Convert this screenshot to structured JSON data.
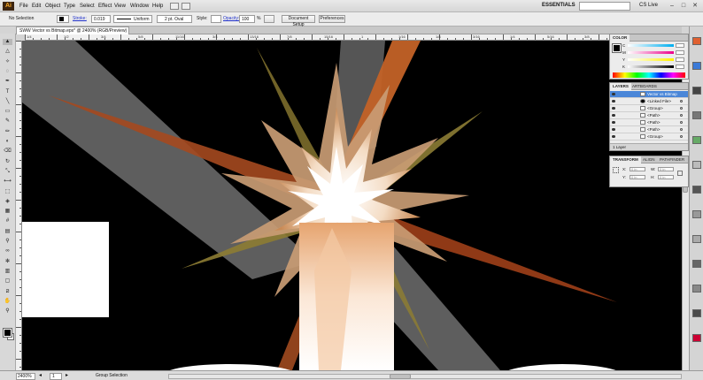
{
  "app": {
    "logo": "Ai"
  },
  "menu": {
    "items": [
      "File",
      "Edit",
      "Object",
      "Type",
      "Select",
      "Effect",
      "View",
      "Window",
      "Help"
    ]
  },
  "workspace": {
    "label": "ESSENTIALS",
    "cslive": "CS Live"
  },
  "control": {
    "selection_label": "No Selection",
    "stroke_label": "Stroke:",
    "stroke_value": "0.019",
    "uniform_label": "Uniform",
    "brush_label": "2 pt. Oval",
    "style_label": "Style:",
    "opacity_label": "Opacity:",
    "opacity_value": "100",
    "opacity_unit": "%",
    "doc_setup": "Document Setup",
    "preferences": "Preferences"
  },
  "document": {
    "tab_title": "SWW Vector vs Bitmap.eps* @ 2400% (RGB/Preview)"
  },
  "rulers": {
    "h_labels": [
      "1/4",
      "1/2",
      "3/4",
      "5/8",
      "11/16",
      "3/4",
      "13/16",
      "7/8",
      "15/16",
      "1",
      "1/16",
      "1/8",
      "3/16",
      "1/4",
      "5/16",
      "3/8",
      "7/16",
      "1/2"
    ]
  },
  "color_panel": {
    "tab": "COLOR",
    "channels": [
      "C",
      "M",
      "Y",
      "K"
    ]
  },
  "layers_panel": {
    "tabs": [
      "LAYERS",
      "ARTBOARDS"
    ],
    "rows": [
      "Vector vs Bitmap",
      "<Linked File>",
      "<Group>",
      "<Path>",
      "<Path>",
      "<Path>",
      "<Group>"
    ],
    "footer": "1 Layer"
  },
  "transform_panel": {
    "tabs": [
      "TRANSFORM",
      "ALIGN",
      "PATHFINDER"
    ],
    "x_label": "X:",
    "y_label": "Y:",
    "w_label": "W:",
    "h_label": "H:",
    "x_value": "0 in",
    "y_value": "0 in",
    "w_value": "0 in",
    "h_value": "0 in"
  },
  "status": {
    "zoom": "2400%",
    "page": "1",
    "tool": "Group Selection"
  },
  "colors": {
    "canvas": "#000000",
    "orange": "#c0622b",
    "tan": "#c9a27a",
    "olive": "#9b8a3c",
    "grey_beam": "#7a7a7a"
  }
}
